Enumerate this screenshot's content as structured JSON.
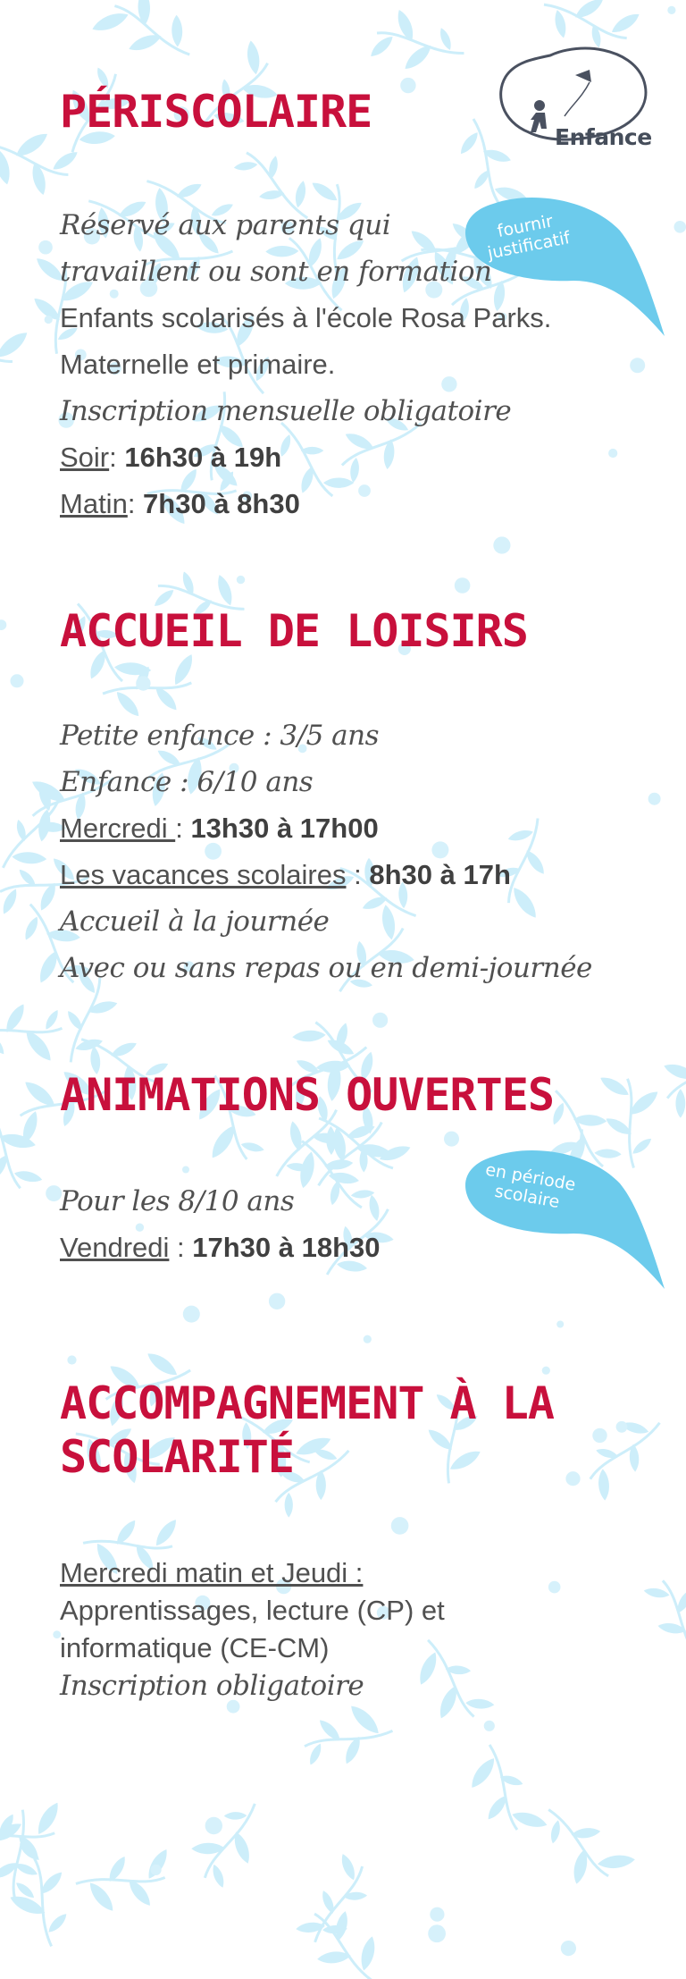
{
  "logo": {
    "label": "Enfance"
  },
  "bubbles": {
    "first": "fournir\njustificatif",
    "second": "en période\nscolaire"
  },
  "periscolaire": {
    "title": "PÉRISCOLAIRE",
    "line1": "Réservé aux parents qui",
    "line2": "travaillent ou sont en formation",
    "line3": "Enfants scolarisés à l'école Rosa Parks.",
    "line4": "Maternelle et primaire.",
    "line5": "Inscription mensuelle obligatoire",
    "soir_label": "Soir",
    "soir_time": "16h30  à  19h",
    "matin_label": "Matin",
    "matin_time": "7h30  à  8h30"
  },
  "accueil": {
    "title": "ACCUEIL DE LOISIRS",
    "line1": "Petite enfance : 3/5 ans",
    "line2": "Enfance : 6/10 ans",
    "mercredi_label": "Mercredi ",
    "mercredi_time": "13h30 à 17h00",
    "vacances_label": "Les vacances scolaires",
    "vacances_time": "8h30 à 17h",
    "line5": "Accueil à la journée",
    "line6": "Avec ou sans repas ou en demi-journée"
  },
  "animations": {
    "title": "ANIMATIONS OUVERTES",
    "line1": "Pour les 8/10 ans",
    "vendredi_label": "Vendredi",
    "vendredi_time": "17h30 à 18h30"
  },
  "accompagnement": {
    "title_line1": "ACCOMPAGNEMENT À LA",
    "title_line2": "SCOLARITÉ",
    "line1": "Mercredi matin et Jeudi :",
    "line2": "Apprentissages,  lecture (CP) et",
    "line3": "informatique (CE-CM)",
    "line4": "Inscription obligatoire"
  }
}
